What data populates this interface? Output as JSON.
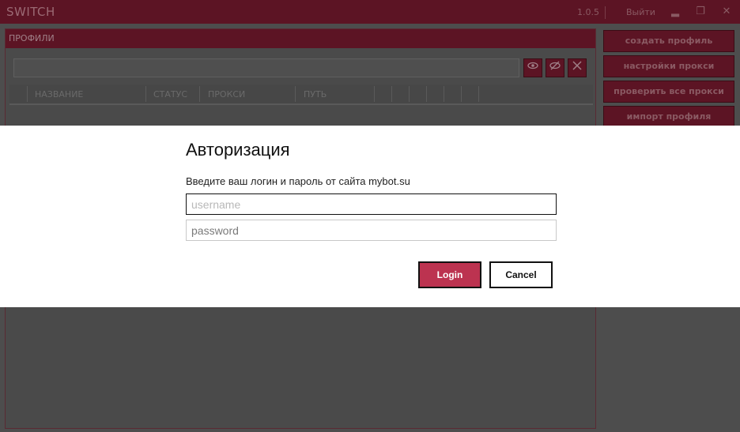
{
  "app": {
    "title": "SWITCH",
    "version": "1.0.5",
    "logout_label": "Выйти",
    "minimize_icon": "minimize-icon",
    "maximize_icon": "maximize-icon",
    "close_icon": "close-icon"
  },
  "profiles": {
    "header": "ПРОФИЛИ",
    "search_value": "",
    "columns": [
      "НАЗВАНИЕ",
      "СТАТУС",
      "ПРОКСИ",
      "ПУТЬ"
    ]
  },
  "sidebar": {
    "buttons": [
      "создать профиль",
      "настройки прокси",
      "проверить все прокси",
      "импорт профиля"
    ]
  },
  "dialog": {
    "title": "Авторизация",
    "subtitle": "Введите ваш логин и пароль от сайта mybot.su",
    "username_placeholder": "username",
    "password_placeholder": "password",
    "login_label": "Login",
    "cancel_label": "Cancel"
  },
  "colors": {
    "accent": "#5c1424",
    "login_button": "#bc3350"
  }
}
